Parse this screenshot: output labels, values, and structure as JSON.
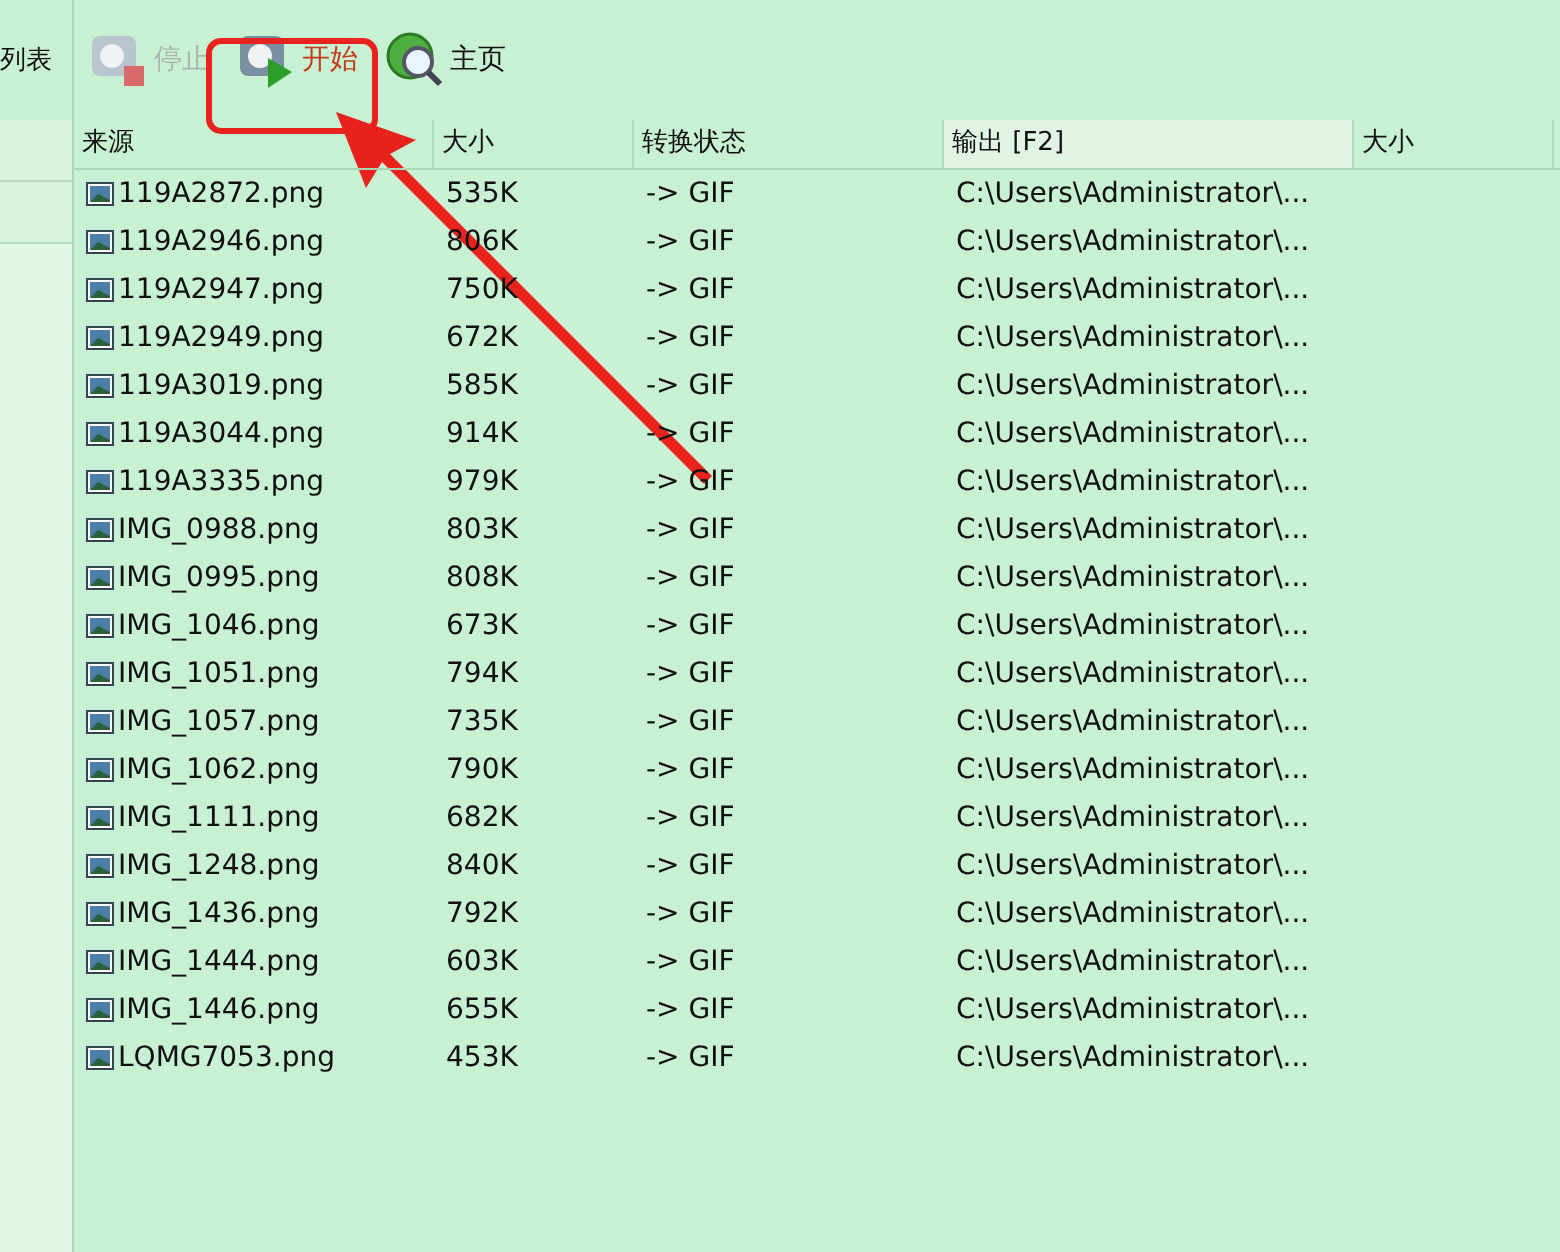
{
  "sidebar": {
    "label": "列表"
  },
  "toolbar": [
    {
      "label": "停止",
      "kind": "stop",
      "disabled": true,
      "highlighted": false
    },
    {
      "label": "开始",
      "kind": "start",
      "disabled": false,
      "highlighted": true
    },
    {
      "label": "主页",
      "kind": "home",
      "disabled": false,
      "highlighted": false
    }
  ],
  "table": {
    "columns": [
      {
        "label": "来源",
        "selected": false
      },
      {
        "label": "大小",
        "selected": false
      },
      {
        "label": "转换状态",
        "selected": false
      },
      {
        "label": "输出 [F2]",
        "selected": true
      },
      {
        "label": "大小",
        "selected": false
      }
    ],
    "rows": [
      [
        "119A2872.png",
        "535K",
        "-> GIF",
        "C:\\Users\\Administrator\\..."
      ],
      [
        "119A2946.png",
        "806K",
        "-> GIF",
        "C:\\Users\\Administrator\\..."
      ],
      [
        "119A2947.png",
        "750K",
        "-> GIF",
        "C:\\Users\\Administrator\\..."
      ],
      [
        "119A2949.png",
        "672K",
        "-> GIF",
        "C:\\Users\\Administrator\\..."
      ],
      [
        "119A3019.png",
        "585K",
        "-> GIF",
        "C:\\Users\\Administrator\\..."
      ],
      [
        "119A3044.png",
        "914K",
        "-> GIF",
        "C:\\Users\\Administrator\\..."
      ],
      [
        "119A3335.png",
        "979K",
        "-> GIF",
        "C:\\Users\\Administrator\\..."
      ],
      [
        "IMG_0988.png",
        "803K",
        "-> GIF",
        "C:\\Users\\Administrator\\..."
      ],
      [
        "IMG_0995.png",
        "808K",
        "-> GIF",
        "C:\\Users\\Administrator\\..."
      ],
      [
        "IMG_1046.png",
        "673K",
        "-> GIF",
        "C:\\Users\\Administrator\\..."
      ],
      [
        "IMG_1051.png",
        "794K",
        "-> GIF",
        "C:\\Users\\Administrator\\..."
      ],
      [
        "IMG_1057.png",
        "735K",
        "-> GIF",
        "C:\\Users\\Administrator\\..."
      ],
      [
        "IMG_1062.png",
        "790K",
        "-> GIF",
        "C:\\Users\\Administrator\\..."
      ],
      [
        "IMG_1111.png",
        "682K",
        "-> GIF",
        "C:\\Users\\Administrator\\..."
      ],
      [
        "IMG_1248.png",
        "840K",
        "-> GIF",
        "C:\\Users\\Administrator\\..."
      ],
      [
        "IMG_1436.png",
        "792K",
        "-> GIF",
        "C:\\Users\\Administrator\\..."
      ],
      [
        "IMG_1444.png",
        "603K",
        "-> GIF",
        "C:\\Users\\Administrator\\..."
      ],
      [
        "IMG_1446.png",
        "655K",
        "-> GIF",
        "C:\\Users\\Administrator\\..."
      ],
      [
        "LQMG7053.png",
        "453K",
        "-> GIF",
        "C:\\Users\\Administrator\\..."
      ]
    ]
  }
}
